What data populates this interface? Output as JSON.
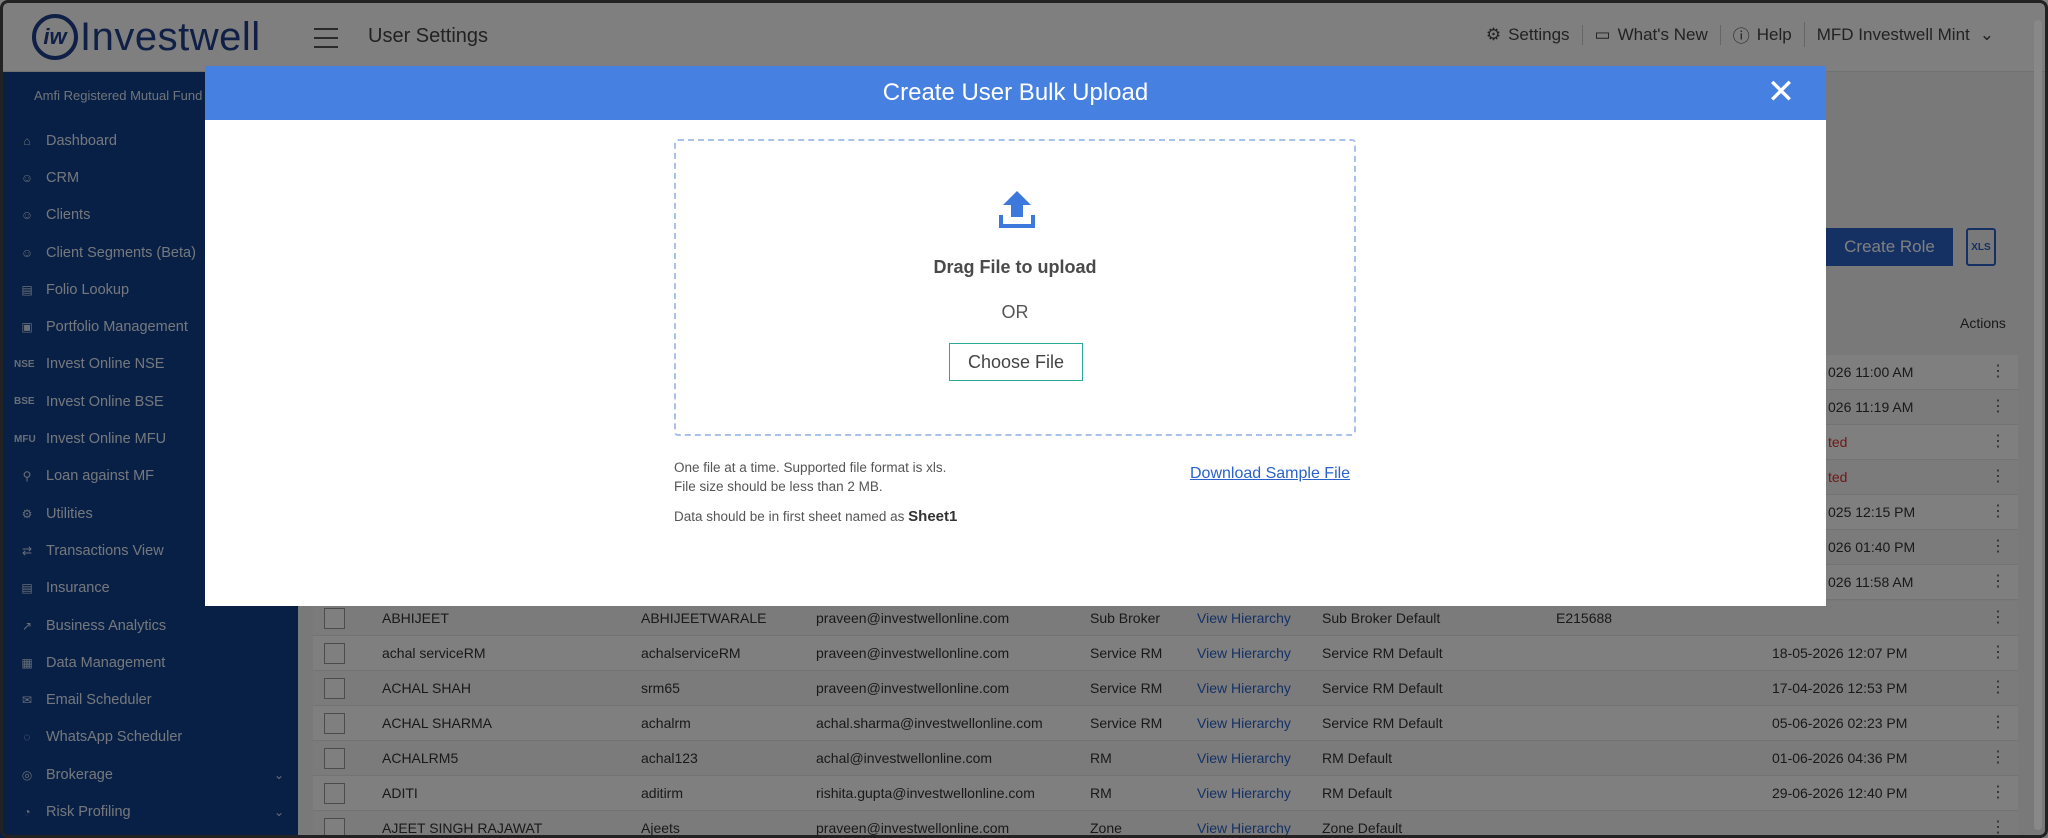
{
  "header": {
    "logo_text": "Investwell",
    "page_title": "User Settings",
    "settings": "Settings",
    "whats_new": "What's New",
    "help": "Help",
    "account": "MFD Investwell Mint"
  },
  "sidebar": {
    "amfi_label": "Amfi Registered Mutual Fund D",
    "items": [
      {
        "label": "Dashboard"
      },
      {
        "label": "CRM"
      },
      {
        "label": "Clients"
      },
      {
        "label": "Client Segments (Beta)"
      },
      {
        "label": "Folio Lookup"
      },
      {
        "label": "Portfolio Management"
      },
      {
        "label": "Invest Online NSE",
        "tag": "NSE"
      },
      {
        "label": "Invest Online BSE",
        "tag": "BSE"
      },
      {
        "label": "Invest Online MFU",
        "tag": "MFU"
      },
      {
        "label": "Loan against MF"
      },
      {
        "label": "Utilities"
      },
      {
        "label": "Transactions View"
      },
      {
        "label": "Insurance"
      },
      {
        "label": "Business Analytics"
      },
      {
        "label": "Data Management"
      },
      {
        "label": "Email Scheduler"
      },
      {
        "label": "WhatsApp Scheduler"
      },
      {
        "label": "Brokerage"
      },
      {
        "label": "Risk Profiling"
      }
    ]
  },
  "toolbar": {
    "create_role": "Create Role",
    "xls": "XLS"
  },
  "table": {
    "actions_header": "Actions",
    "partial_rows": [
      {
        "date": "026 11:00 AM"
      },
      {
        "date": "026 11:19 AM"
      },
      {
        "date": "ted"
      },
      {
        "date": "ted"
      },
      {
        "date": "025 12:15 PM"
      },
      {
        "date": "026 01:40 PM"
      },
      {
        "date": "026 11:58 AM"
      }
    ],
    "rows": [
      {
        "name": "ABHIJEET",
        "username": "ABHIJEETWARALE",
        "email": "praveen@investwellonline.com",
        "type": "Sub Broker",
        "hierarchy": "View Hierarchy",
        "role": "Sub Broker Default",
        "code": "E215688",
        "date": ""
      },
      {
        "name": "achal serviceRM",
        "username": "achalserviceRM",
        "email": "praveen@investwellonline.com",
        "type": "Service RM",
        "hierarchy": "View Hierarchy",
        "role": "Service RM Default",
        "code": "",
        "date": "18-05-2026 12:07 PM"
      },
      {
        "name": "ACHAL SHAH",
        "username": "srm65",
        "email": "praveen@investwellonline.com",
        "type": "Service RM",
        "hierarchy": "View Hierarchy",
        "role": "Service RM Default",
        "code": "",
        "date": "17-04-2026 12:53 PM"
      },
      {
        "name": "ACHAL SHARMA",
        "username": "achalrm",
        "email": "achal.sharma@investwellonline.com",
        "type": "Service RM",
        "hierarchy": "View Hierarchy",
        "role": "Service RM Default",
        "code": "",
        "date": "05-06-2026 02:23 PM"
      },
      {
        "name": "ACHALRM5",
        "username": "achal123",
        "email": "achal@investwellonline.com",
        "type": "RM",
        "hierarchy": "View Hierarchy",
        "role": "RM Default",
        "code": "",
        "date": "01-06-2026 04:36 PM"
      },
      {
        "name": "ADITI",
        "username": "aditirm",
        "email": "rishita.gupta@investwellonline.com",
        "type": "RM",
        "hierarchy": "View Hierarchy",
        "role": "RM Default",
        "code": "",
        "date": "29-06-2026 12:40 PM"
      },
      {
        "name": "AJEET SINGH RAJAWAT",
        "username": "Ajeets",
        "email": "praveen@investwellonline.com",
        "type": "Zone",
        "hierarchy": "View Hierarchy",
        "role": "Zone Default",
        "code": "",
        "date": ""
      }
    ]
  },
  "modal": {
    "title": "Create User Bulk Upload",
    "close": "✕",
    "drag_text": "Drag File to upload",
    "or_text": "OR",
    "choose_file": "Choose File",
    "note_line1": "One file at a time. Supported file format is xls.",
    "note_line2": "File size should be less than 2 MB.",
    "sheet_note": "Data should be in first sheet named as",
    "sheet_name": "Sheet1",
    "download_link": "Download Sample File"
  },
  "colors": {
    "modal_header": "#4680e0",
    "sidebar_bg": "#11408a",
    "accent": "#2a62c9",
    "choose_border": "#28a99a"
  }
}
